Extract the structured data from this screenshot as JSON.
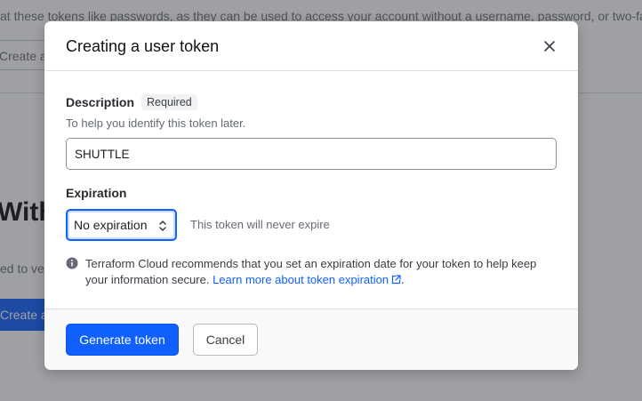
{
  "background": {
    "top_text": "at these tokens like passwords, as they can be used to access your account without a username, password, or two-fac",
    "outline_button_label": "Create a",
    "heading": "Withu",
    "subtext": "ed to ver",
    "primary_button_label": "Create a"
  },
  "modal": {
    "title": "Creating a user token",
    "close_icon": "close-icon",
    "description": {
      "label": "Description",
      "badge": "Required",
      "helper": "To help you identify this token later.",
      "value": "SHUTTLE"
    },
    "expiration": {
      "label": "Expiration",
      "selected": "No expiration",
      "note": "This token will never expire"
    },
    "info": {
      "icon": "info-icon",
      "text": "Terraform Cloud recommends that you set an expiration date for your token to help keep your information secure.",
      "link": "Learn more about token expiration",
      "suffix": "."
    },
    "footer": {
      "generate_label": "Generate token",
      "cancel_label": "Cancel"
    }
  },
  "colors": {
    "accent": "#1060ff",
    "overlay": "#2d3036"
  }
}
